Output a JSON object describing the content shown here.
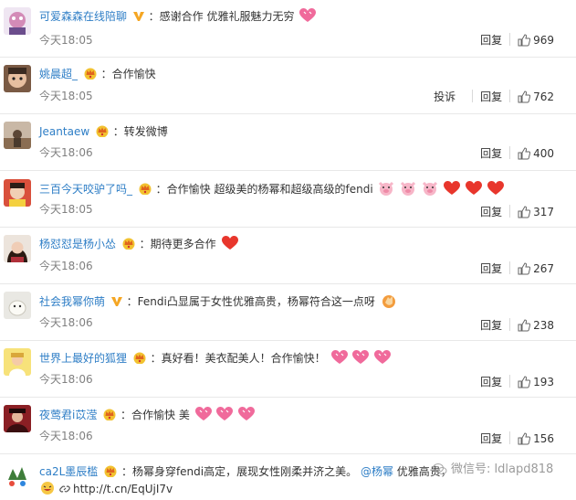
{
  "comments": [
    {
      "user": "可爱森森在线陪聊",
      "badge": "v",
      "text": "：感谢合作 优雅礼服魅力无穷",
      "emojis": [
        "heart-pink"
      ],
      "time": "今天18:05",
      "reply": "回复",
      "likes": "969",
      "report": ""
    },
    {
      "user": "姚晨超_",
      "badge": "crown",
      "text": "：合作愉快",
      "emojis": [],
      "time": "今天18:05",
      "reply": "回复",
      "likes": "762",
      "report": "投诉"
    },
    {
      "user": "Jeantaew",
      "badge": "crown",
      "text": "：转发微博",
      "emojis": [],
      "time": "今天18:06",
      "reply": "回复",
      "likes": "400",
      "report": ""
    },
    {
      "user": "三百今天咬驴了吗_",
      "badge": "crown",
      "text": "：合作愉快 超级美的杨幂和超级高级的fendi",
      "emojis": [
        "pig",
        "pig",
        "pig",
        "heart-red",
        "heart-red",
        "heart-red"
      ],
      "time": "今天18:05",
      "reply": "回复",
      "likes": "317",
      "report": ""
    },
    {
      "user": "杨怼怼是杨小怂",
      "badge": "crown",
      "text": "：期待更多合作",
      "emojis": [
        "heart-red"
      ],
      "time": "今天18:06",
      "reply": "回复",
      "likes": "267",
      "report": ""
    },
    {
      "user": "社会我幂你萌",
      "badge": "v",
      "text": "：Fendi凸显属于女性优雅高贵，杨幂符合这一点呀",
      "emojis": [
        "clap"
      ],
      "time": "今天18:06",
      "reply": "回复",
      "likes": "238",
      "report": ""
    },
    {
      "user": "世界上最好的狐狸",
      "badge": "crown",
      "text": "：真好看！美衣配美人！合作愉快！",
      "emojis": [
        "heart-pink",
        "heart-pink",
        "heart-pink"
      ],
      "time": "今天18:06",
      "reply": "回复",
      "likes": "193",
      "report": ""
    },
    {
      "user": "夜莺君i苡滢",
      "badge": "crown",
      "text": "：合作愉快 美",
      "emojis": [
        "heart-pink",
        "heart-pink",
        "heart-pink"
      ],
      "time": "今天18:06",
      "reply": "回复",
      "likes": "156",
      "report": ""
    },
    {
      "user": "ca2L墨辰槛",
      "badge": "crown",
      "text": "：杨幂身穿fendi高定，展现女性刚柔并济之美。",
      "mention": "@杨幂",
      "text_after": " 优雅高贵，",
      "link": "http://t.cn/EqUjI7v",
      "emojis": [],
      "time": "",
      "reply": "",
      "likes": "",
      "report": ""
    }
  ],
  "watermark": {
    "text": "微信号: ldlapd818"
  },
  "colors": {
    "username": "#2e7ec6",
    "time": "#808080",
    "separator": "#e8e8e8",
    "heart_red": "#e8362c",
    "heart_pink": "#f06a9b"
  }
}
